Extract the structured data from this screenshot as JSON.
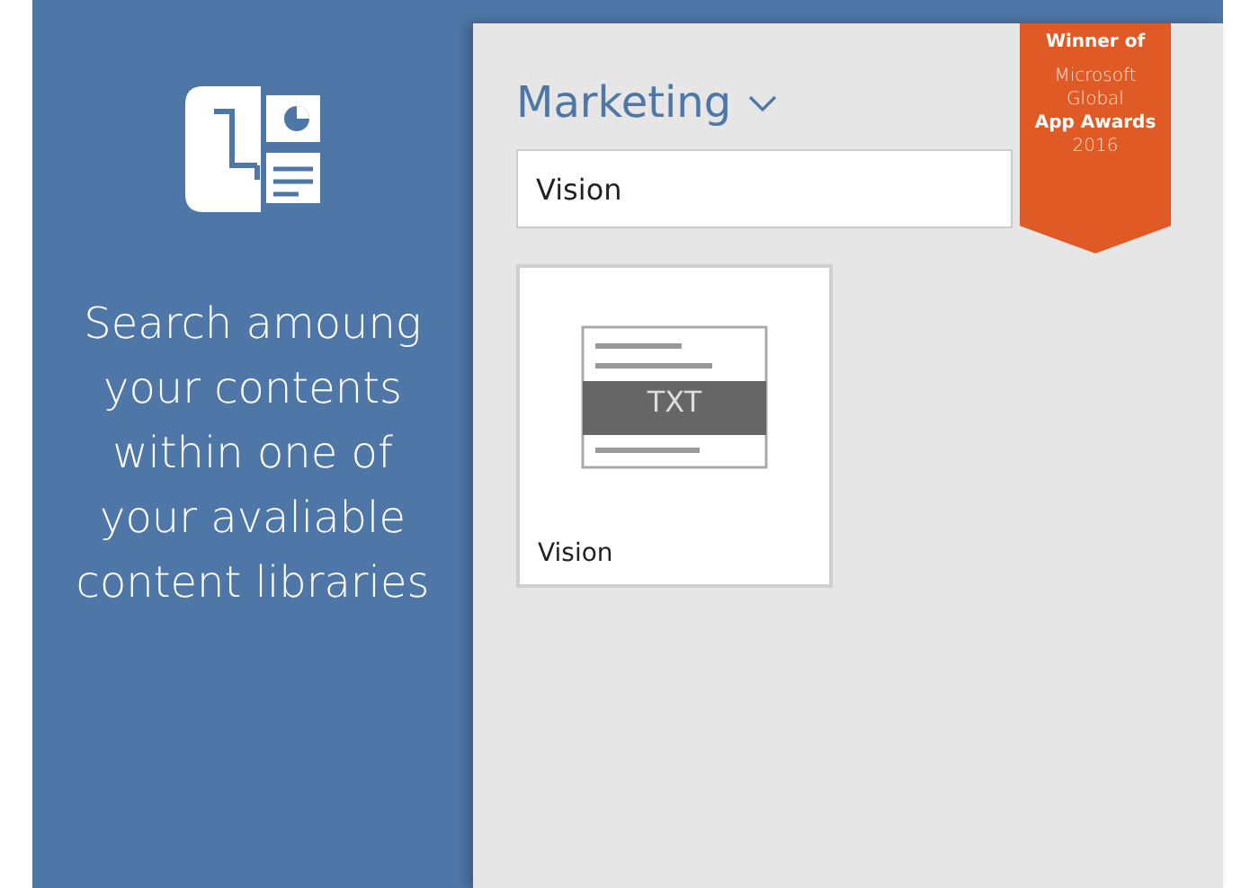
{
  "sidebar": {
    "message": "Search amoung your contents within one of your avaliable content libraries"
  },
  "library": {
    "title": "Marketing",
    "expanded": false
  },
  "search": {
    "value": "Vision"
  },
  "results": [
    {
      "title": "Vision",
      "file_type": "TXT"
    }
  ],
  "award_badge": {
    "lines": [
      {
        "text": "Winner of",
        "bold": true
      },
      {
        "text": "Microsoft",
        "bold": false
      },
      {
        "text": "Global",
        "bold": false
      },
      {
        "text": "App Awards",
        "bold": true
      },
      {
        "text": "2016",
        "bold": false
      }
    ]
  }
}
